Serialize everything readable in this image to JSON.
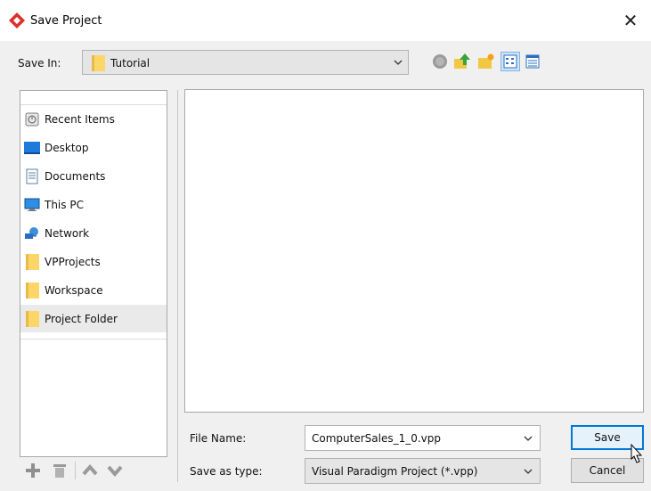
{
  "window": {
    "title": "Save Project",
    "close_glyph": "✕",
    "icon": "visual-paradigm-logo-icon"
  },
  "save_in": {
    "label": "Save In:",
    "value": "Tutorial",
    "icon": "folder-icon"
  },
  "toolbar": {
    "icons": [
      "back-icon",
      "up-one-level-icon",
      "create-new-folder-icon",
      "list-view-icon",
      "details-view-icon"
    ],
    "selected": "list-view-icon"
  },
  "places": {
    "items": [
      {
        "label": "Recent Items",
        "icon": "recent-items-icon"
      },
      {
        "label": "Desktop",
        "icon": "desktop-icon"
      },
      {
        "label": "Documents",
        "icon": "documents-icon"
      },
      {
        "label": "This PC",
        "icon": "this-pc-icon"
      },
      {
        "label": "Network",
        "icon": "network-icon"
      },
      {
        "label": "VPProjects",
        "icon": "folder-icon"
      },
      {
        "label": "Workspace",
        "icon": "folder-icon"
      },
      {
        "label": "Project Folder",
        "icon": "folder-icon"
      }
    ],
    "selected_index": 7,
    "actions": [
      "add-icon",
      "delete-icon",
      "move-up-icon",
      "move-down-icon"
    ]
  },
  "form": {
    "file_name_label": "File Name:",
    "file_name_value": "ComputerSales_1_0.vpp",
    "save_type_label": "Save as type:",
    "save_type_value": "Visual Paradigm Project (*.vpp)"
  },
  "buttons": {
    "save": "Save",
    "cancel": "Cancel"
  },
  "colors": {
    "accent": "#0078d7",
    "folder": "#fcd768",
    "logo": "#d9322c"
  }
}
